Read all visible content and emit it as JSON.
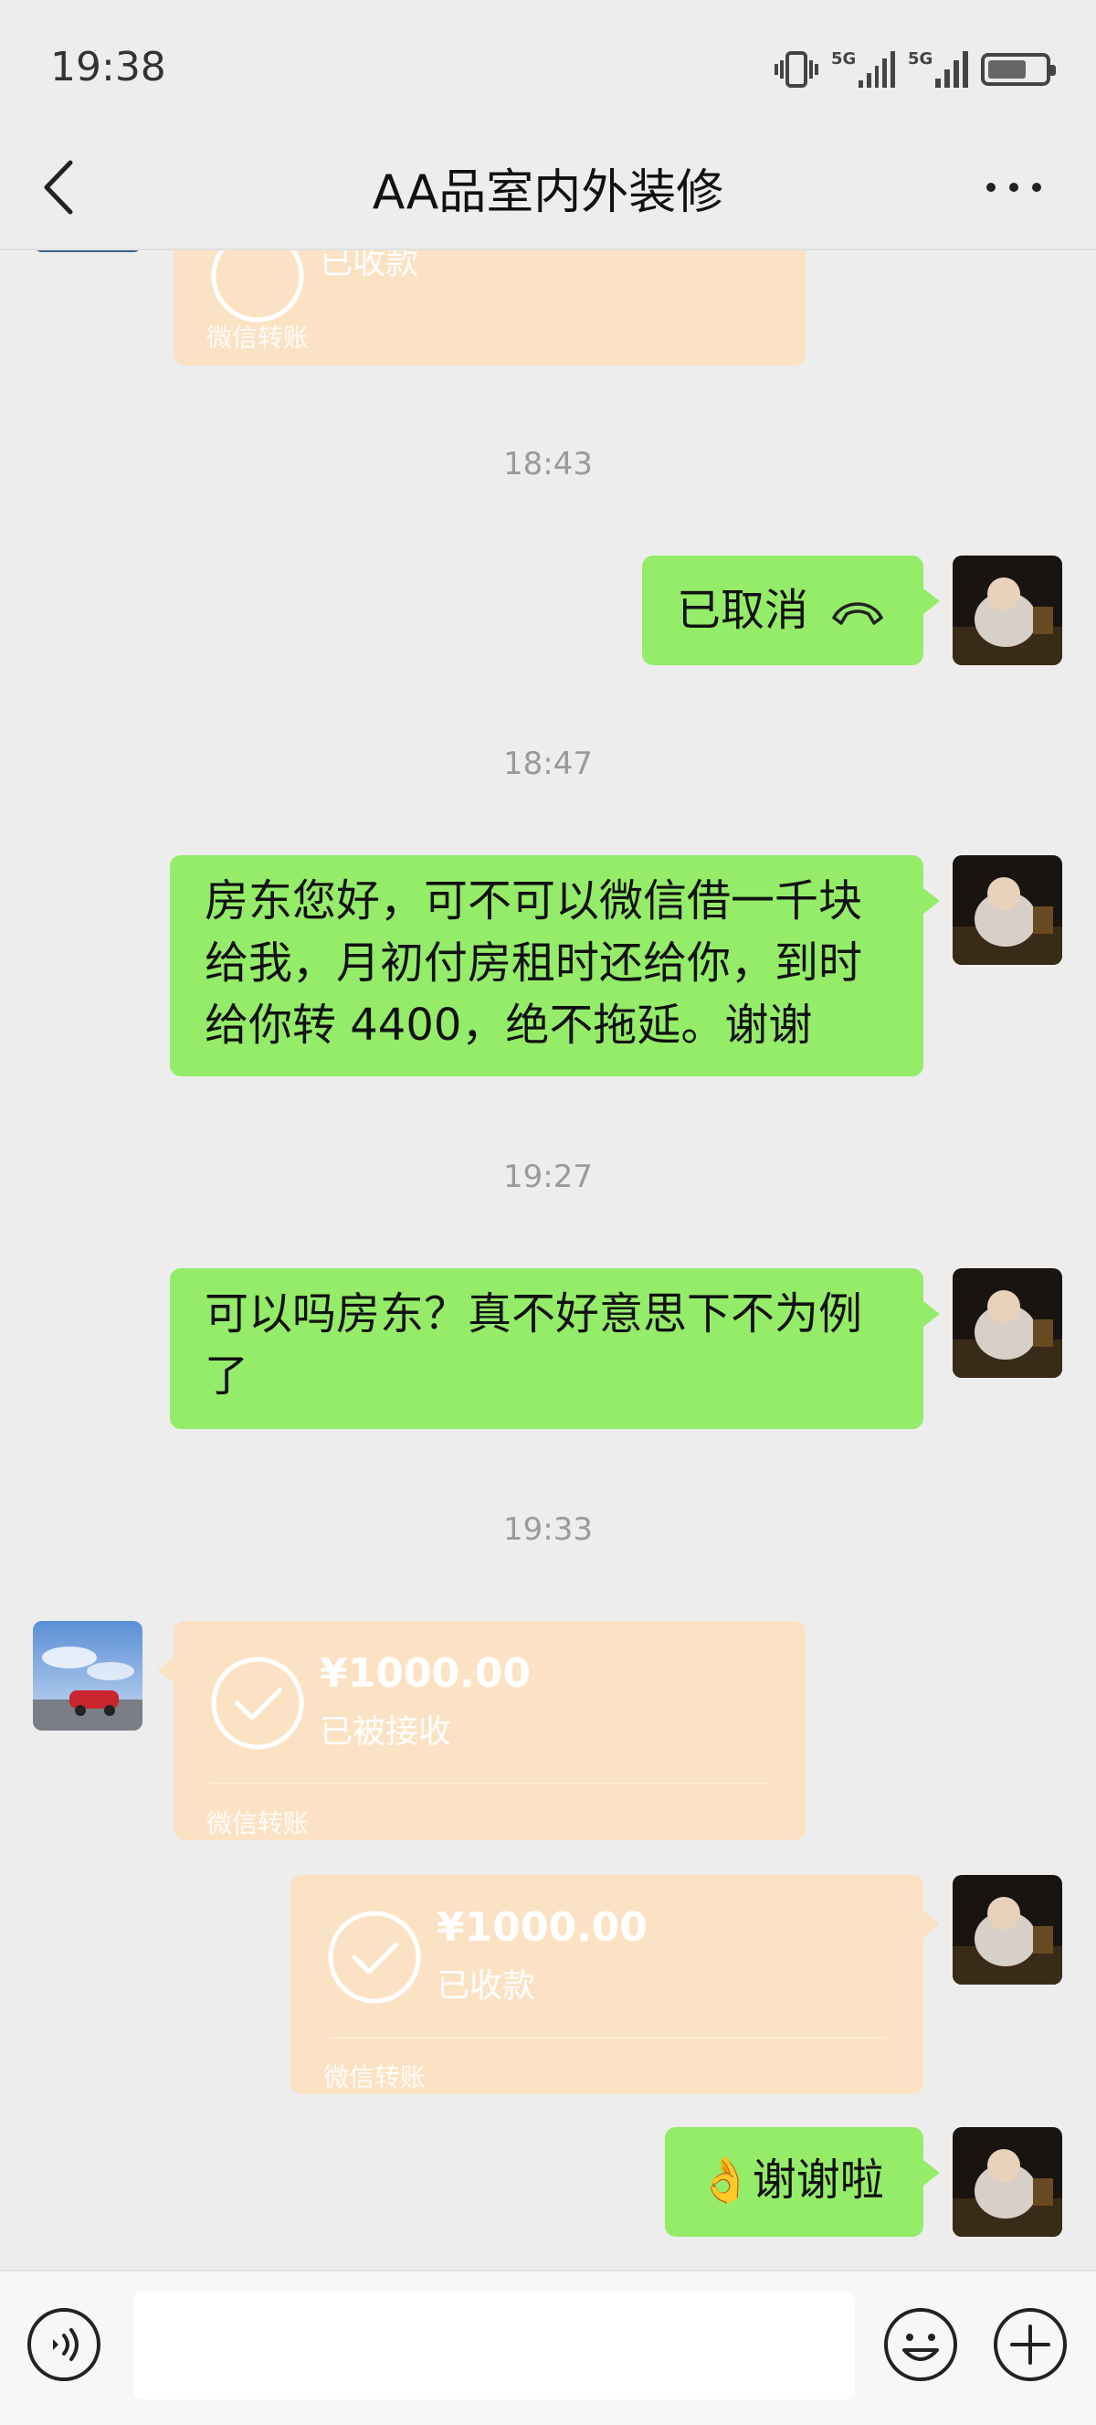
{
  "status_bar": {
    "time": "19:38",
    "network_1": "5G",
    "network_2": "5G",
    "icons": [
      "vibrate-icon",
      "signal-icon",
      "signal-icon",
      "battery-charging-icon"
    ]
  },
  "nav": {
    "title": "AA品室内外装修",
    "back_icon": "chevron-left-icon",
    "more_icon": "more-icon"
  },
  "messages": {
    "top_transfer": {
      "status": "已收款",
      "footer": "微信转账"
    },
    "ts_1": "18:43",
    "call": {
      "text": "已取消",
      "icon": "hangup-icon"
    },
    "ts_2": "18:47",
    "msg_1": {
      "line_1": "房东您好，可不可以微信借一千块",
      "line_2": "给我，月初付房租时还给你，到时",
      "line_3": "给你转 4400，绝不拖延。谢谢"
    },
    "ts_3": "19:27",
    "msg_2": {
      "line_1": "可以吗房东？真不好意思下不为例",
      "line_2": "了"
    },
    "ts_4": "19:33",
    "transfer_in": {
      "amount": "¥1000.00",
      "status": "已被接收",
      "footer": "微信转账"
    },
    "transfer_out": {
      "amount": "¥1000.00",
      "status": "已收款",
      "footer": "微信转账"
    },
    "msg_3": {
      "emoji": "👌",
      "text": "谢谢啦"
    }
  },
  "input_bar": {
    "icons": [
      "voice-icon",
      "emoji-icon",
      "plus-icon"
    ]
  },
  "colors": {
    "background": "#ededed",
    "self_bubble": "#95ec69",
    "transfer_bubble": "#fce2c4",
    "timestamp": "#9a9a9a"
  }
}
